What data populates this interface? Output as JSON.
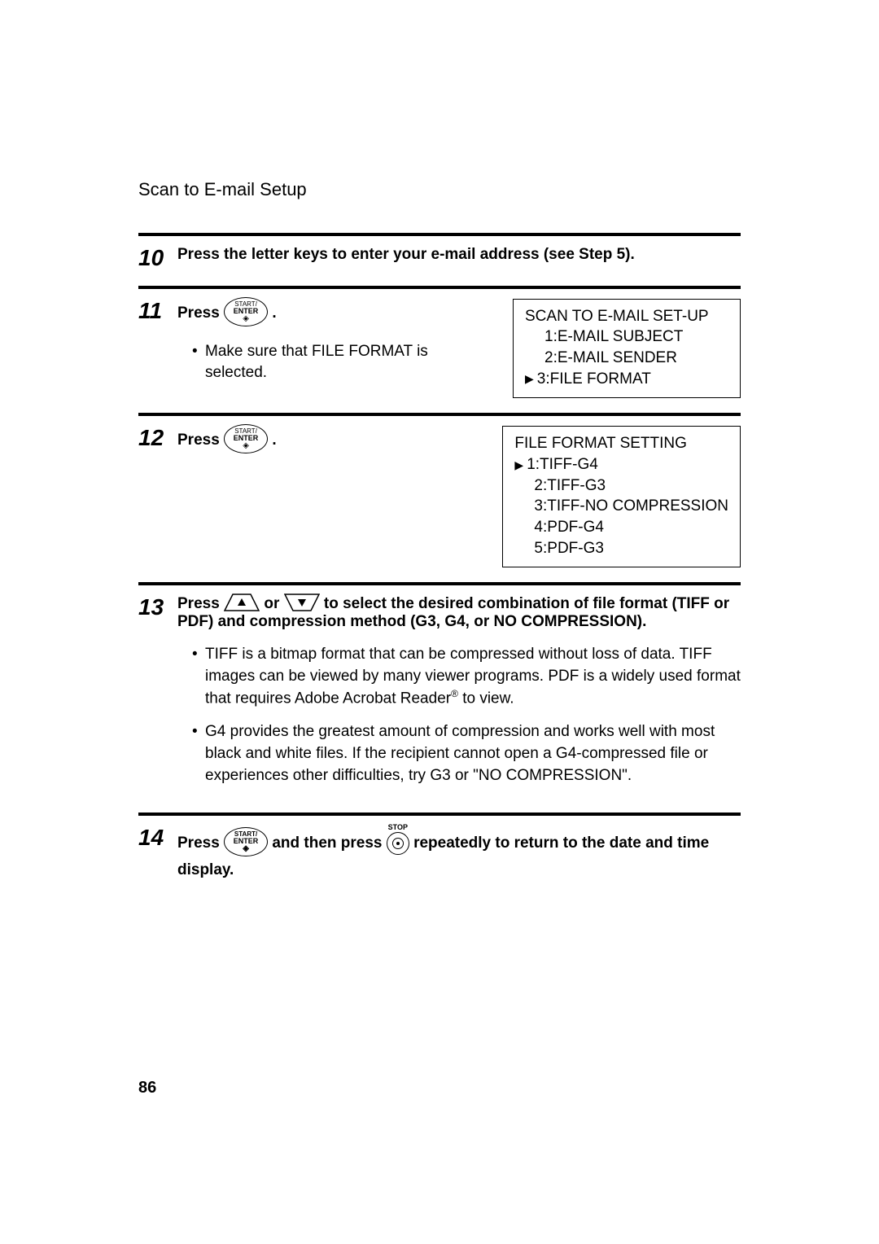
{
  "header": "Scan to E-mail Setup",
  "steps": {
    "s10": {
      "num": "10",
      "text": "Press the letter keys to enter your e-mail address (see Step 5)."
    },
    "s11": {
      "num": "11",
      "press": "Press",
      "dot": ".",
      "bullet": "Make sure that FILE FORMAT is selected.",
      "lcd": {
        "title": "SCAN TO E-MAIL SET-UP",
        "l1": "1:E-MAIL SUBJECT",
        "l2": "2:E-MAIL SENDER",
        "l3": "3:FILE FORMAT"
      }
    },
    "s12": {
      "num": "12",
      "press": "Press",
      "dot": ".",
      "lcd": {
        "title": "FILE FORMAT SETTING",
        "l1": "1:TIFF-G4",
        "l2": "2:TIFF-G3",
        "l3": "3:TIFF-NO COMPRESSION",
        "l4": "4:PDF-G4",
        "l5": "5:PDF-G3"
      }
    },
    "s13": {
      "num": "13",
      "lead_press": "Press",
      "lead_or": "or",
      "lead_tail": "to select the desired combination of file format (TIFF or PDF) and compression method (G3, G4, or NO COMPRESSION).",
      "bullet1a": "TIFF is a bitmap format that can be compressed without loss of data. TIFF images can be viewed by many viewer programs. PDF is a widely used format that requires Adobe Acrobat Reader",
      "bullet1b": " to view.",
      "bullet2": "G4 provides the greatest amount of compression and works well with most black and white files. If the recipient cannot open a G4-compressed file or experiences other difficulties, try G3 or \"NO COMPRESSION\"."
    },
    "s14": {
      "num": "14",
      "t1": "Press",
      "t2": "and then press",
      "t3": "repeatedly to return to the date and time display."
    }
  },
  "icons": {
    "start_l1": "START/",
    "start_l2": "ENTER",
    "stop_label": "STOP",
    "reg": "®",
    "tri_right": "▶"
  },
  "page_number": "86"
}
